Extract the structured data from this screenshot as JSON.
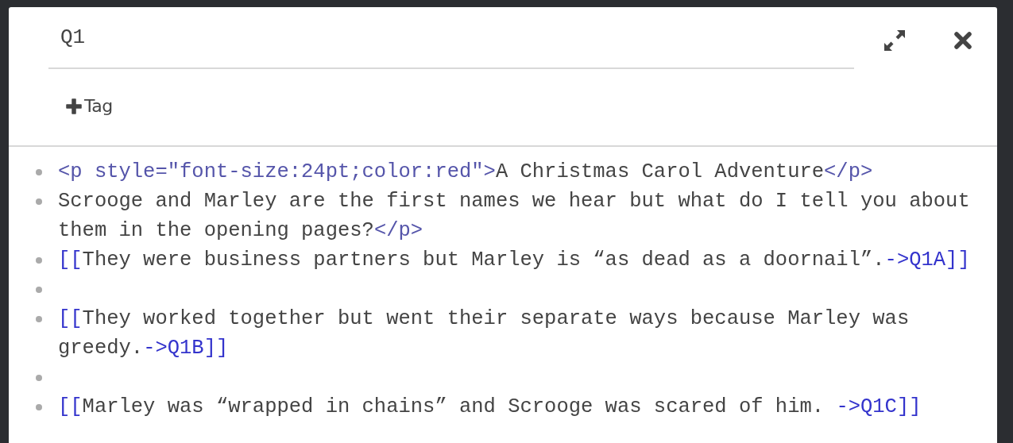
{
  "passage": {
    "name": "Q1"
  },
  "toolbar": {
    "tag_button": "Tag"
  },
  "lines": [
    {
      "kind": "text",
      "segments": [
        {
          "kind": "markup",
          "text": "<p style=\"font-size:24pt;color:red\">"
        },
        {
          "kind": "plain",
          "text": "A Christmas Carol Adventure"
        },
        {
          "kind": "markup",
          "text": "</p>"
        }
      ]
    },
    {
      "kind": "text",
      "segments": [
        {
          "kind": "plain",
          "text": "Scrooge and Marley are the first names we hear but what do I tell you about them in the opening pages?"
        },
        {
          "kind": "markup",
          "text": "</p>"
        }
      ]
    },
    {
      "kind": "text",
      "segments": [
        {
          "kind": "link",
          "text": "[["
        },
        {
          "kind": "plain",
          "text": "They were business partners but Marley is “as dead as a doornail”."
        },
        {
          "kind": "link",
          "text": "->Q1A]]"
        }
      ]
    },
    {
      "kind": "blank"
    },
    {
      "kind": "text",
      "segments": [
        {
          "kind": "link",
          "text": "[["
        },
        {
          "kind": "plain",
          "text": "They worked together but went their separate ways because Marley was greedy."
        },
        {
          "kind": "link",
          "text": "->Q1B]]"
        }
      ]
    },
    {
      "kind": "blank"
    },
    {
      "kind": "text",
      "segments": [
        {
          "kind": "link",
          "text": "[["
        },
        {
          "kind": "plain",
          "text": "Marley was “wrapped in chains” and Scrooge was scared of him. "
        },
        {
          "kind": "link",
          "text": "->Q1C]]"
        }
      ]
    }
  ]
}
